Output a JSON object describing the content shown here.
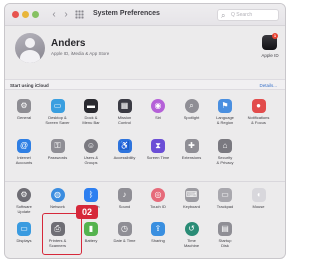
{
  "window": {
    "title": "System Preferences",
    "search_placeholder": "Q Search"
  },
  "account": {
    "name": "Anders",
    "subtitle": "Apple ID, iMedia & App Store",
    "apple_id_label": "Apple ID",
    "apple_id_badge": "1"
  },
  "icloud": {
    "text": "Start using iCloud",
    "details": "Details..."
  },
  "rows": [
    [
      {
        "label": "General",
        "icon": "general-icon",
        "color": "#8e8d93"
      },
      {
        "label": "Desktop &\nScreen Saver",
        "icon": "desktop-icon",
        "color": "#3a9fe0"
      },
      {
        "label": "Dock &\nMenu Bar",
        "icon": "dock-icon",
        "color": "#2a2a30"
      },
      {
        "label": "Mission\nControl",
        "icon": "mission-control-icon",
        "color": "#3b3b44"
      },
      {
        "label": "Siri",
        "icon": "siri-icon",
        "color": "#b560d8"
      },
      {
        "label": "Spotlight",
        "icon": "spotlight-icon",
        "color": "#8f8e95"
      },
      {
        "label": "Language\n& Region",
        "icon": "language-icon",
        "color": "#4a8fe0"
      },
      {
        "label": "Notifications\n& Focus",
        "icon": "notifications-icon",
        "color": "#e24c4c"
      }
    ],
    [
      {
        "label": "Internet\nAccounts",
        "icon": "internet-accounts-icon",
        "color": "#2f7fe4"
      },
      {
        "label": "Passwords",
        "icon": "passwords-icon",
        "color": "#8f8e95"
      },
      {
        "label": "Users &\nGroups",
        "icon": "users-icon",
        "color": "#7a7980"
      },
      {
        "label": "Accessibility",
        "icon": "accessibility-icon",
        "color": "#2e74dd"
      },
      {
        "label": "Screen Time",
        "icon": "screen-time-icon",
        "color": "#6b4ed6"
      },
      {
        "label": "Extensions",
        "icon": "extensions-icon",
        "color": "#8f8e95"
      },
      {
        "label": "Security\n& Privacy",
        "icon": "security-icon",
        "color": "#7a7980"
      }
    ],
    [
      {
        "label": "Software\nUpdate",
        "icon": "software-update-icon",
        "color": "#6e6d74"
      },
      {
        "label": "Network",
        "icon": "network-icon",
        "color": "#3b8de0"
      },
      {
        "label": "Bluetooth",
        "icon": "bluetooth-icon",
        "color": "#2d7ff0"
      },
      {
        "label": "Sound",
        "icon": "sound-icon",
        "color": "#8f8e95"
      },
      {
        "label": "Touch ID",
        "icon": "touch-id-icon",
        "color": "#e66a7a"
      },
      {
        "label": "Keyboard",
        "icon": "keyboard-icon",
        "color": "#9d9ca2"
      },
      {
        "label": "Trackpad",
        "icon": "trackpad-icon",
        "color": "#a9a8ae"
      },
      {
        "label": "Mouse",
        "icon": "mouse-icon",
        "color": "#d8d7dc"
      }
    ],
    [
      {
        "label": "Displays",
        "icon": "displays-icon",
        "color": "#3a9be0"
      },
      {
        "label": "Printers &\nScanners",
        "icon": "printer-icon",
        "color": "#6f6e75"
      },
      {
        "label": "Battery",
        "icon": "battery-icon",
        "color": "#54b34e"
      },
      {
        "label": "Date & Time",
        "icon": "date-time-icon",
        "color": "#8f8e95"
      },
      {
        "label": "Sharing",
        "icon": "sharing-icon",
        "color": "#3a8fe0"
      },
      {
        "label": "Time\nMachine",
        "icon": "time-machine-icon",
        "color": "#2a8c76"
      },
      {
        "label": "Startup\nDisk",
        "icon": "startup-disk-icon",
        "color": "#8f8e95"
      }
    ]
  ],
  "callout": {
    "label": "02"
  }
}
